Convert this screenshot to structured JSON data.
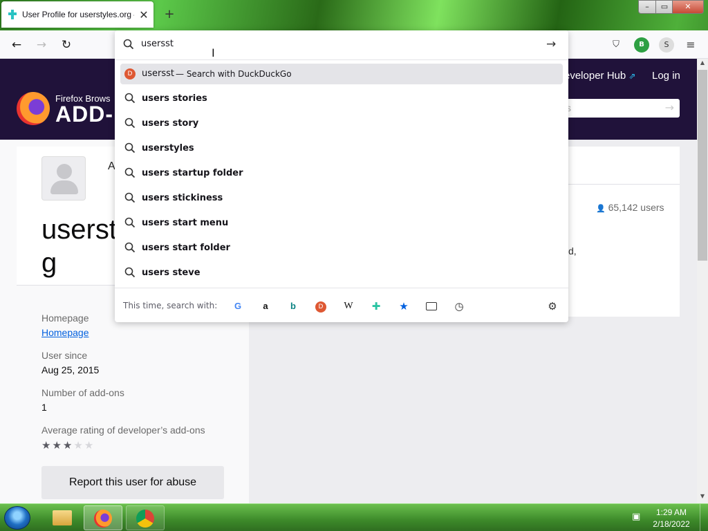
{
  "tab": {
    "title": "User Profile for userstyles.org –",
    "close": "✕",
    "new_tab": "+"
  },
  "window_controls": {
    "minimize": "–",
    "maximize": "▭",
    "close": "✕"
  },
  "nav": {
    "back": "←",
    "forward": "→",
    "reload": "↻"
  },
  "extensions": {
    "pocket": "⛉",
    "b_badge": "B",
    "s_badge": "S",
    "menu": "≡"
  },
  "amo": {
    "brand_small": "Firefox Brows",
    "brand_big": "ADD-",
    "developer_hub": "eveloper Hub",
    "developer_hub_icon": "⇗",
    "login": "Log in",
    "search_placeholder": "s",
    "search_arrow": "→"
  },
  "profile": {
    "avatar_label": "A",
    "username": "userst\ng",
    "homepage_label": "Homepage",
    "homepage_link": "Homepage",
    "user_since_label": "User since",
    "user_since_value": "Aug 25, 2015",
    "num_addons_label": "Number of add-ons",
    "num_addons_value": "1",
    "avg_rating_label": "Average rating of developer’s add-ons",
    "rating": 3,
    "rating_max": 5,
    "report_button": "Report this user for abuse"
  },
  "addon_panel": {
    "users_count": "65,142 users",
    "users_icon": "👤",
    "fragment": "d,"
  },
  "urlbar": {
    "query": "usersst",
    "go_icon": "→",
    "heuristic": {
      "text": "usersst",
      "action": "— Search with DuckDuckGo"
    },
    "suggestions": [
      "users stories",
      "users story",
      "userstyles",
      "users startup folder",
      "users stickiness",
      "users start menu",
      "users start folder",
      "users steve"
    ],
    "one_off_label": "This time, search with:",
    "engines": {
      "google": "G",
      "amazon": "a",
      "bing": "b",
      "ddg": "D",
      "wikipedia": "W",
      "addons": "✚",
      "bookmarks": "★",
      "history": "◷",
      "settings": "⚙"
    }
  },
  "taskbar": {
    "time": "1:29 AM",
    "date": "2/18/2022"
  },
  "colors": {
    "amo_header": "#20123a",
    "link": "#0060df",
    "ddg": "#de5833"
  }
}
